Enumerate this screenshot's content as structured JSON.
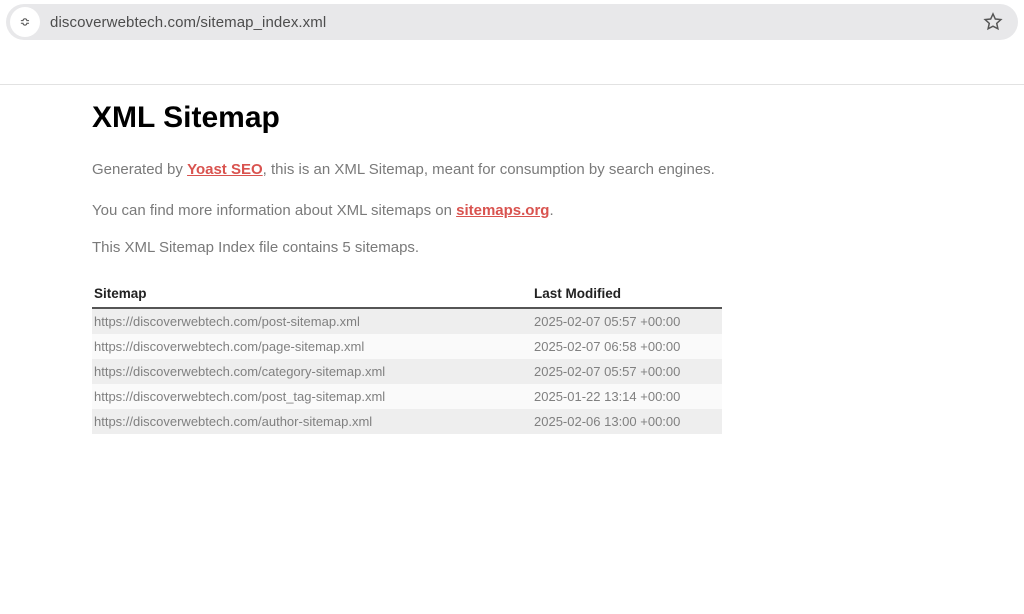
{
  "address_bar": {
    "site_badge_glyph": "≎",
    "url": "discoverwebtech.com/sitemap_index.xml"
  },
  "page": {
    "title": "XML Sitemap",
    "intro_prefix": "Generated by ",
    "intro_link": "Yoast SEO",
    "intro_suffix": ", this is an XML Sitemap, meant for consumption by search engines.",
    "info2_prefix": "You can find more information about XML sitemaps on ",
    "info2_link": "sitemaps.org",
    "info2_suffix": ".",
    "count_line": "This XML Sitemap Index file contains 5 sitemaps."
  },
  "table": {
    "headers": {
      "sitemap": "Sitemap",
      "last_modified": "Last Modified"
    },
    "rows": [
      {
        "url": "https://discoverwebtech.com/post-sitemap.xml",
        "lastmod": "2025-02-07 05:57 +00:00"
      },
      {
        "url": "https://discoverwebtech.com/page-sitemap.xml",
        "lastmod": "2025-02-07 06:58 +00:00"
      },
      {
        "url": "https://discoverwebtech.com/category-sitemap.xml",
        "lastmod": "2025-02-07 05:57 +00:00"
      },
      {
        "url": "https://discoverwebtech.com/post_tag-sitemap.xml",
        "lastmod": "2025-01-22 13:14 +00:00"
      },
      {
        "url": "https://discoverwebtech.com/author-sitemap.xml",
        "lastmod": "2025-02-06 13:00 +00:00"
      }
    ]
  }
}
